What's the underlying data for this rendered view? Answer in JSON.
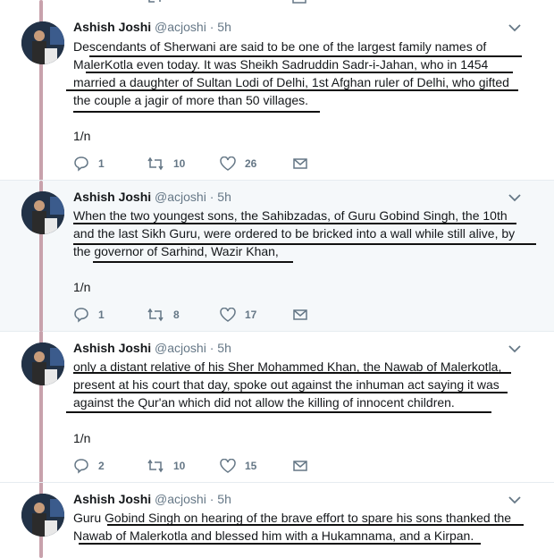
{
  "colors": {
    "thread_line": "#c8a2ac",
    "highlight_bg": "#f5f8fa",
    "meta": "#657786"
  },
  "tweets": [
    {
      "name": "Ashish Joshi",
      "handle": "@acjoshi",
      "dot": "·",
      "time": "5h",
      "lines": [
        "Descendants of Sherwani are said to be one of the largest family names of",
        "MalerKotla even today. It was  Sheikh Sadruddin Sadr-i-Jahan, who in 1454",
        "married a daughter of Sultan Lodi of Delhi, 1st Afghan ruler of Delhi, who gifted",
        "the couple a jagir of more than 50 villages."
      ],
      "count": "1/n",
      "replies": "1",
      "retweets": "10",
      "likes": "26",
      "highlighted": false
    },
    {
      "name": "Ashish Joshi",
      "handle": "@acjoshi",
      "dot": "·",
      "time": "5h",
      "lines": [
        "When the two youngest sons, the Sahibzadas, of Guru Gobind Singh, the 10th",
        "and the last Sikh Guru, were ordered to be bricked into a wall while still alive, by",
        "the governor of Sarhind, Wazir Khan,"
      ],
      "count": "1/n",
      "replies": "1",
      "retweets": "8",
      "likes": "17",
      "highlighted": true
    },
    {
      "name": "Ashish Joshi",
      "handle": "@acjoshi",
      "dot": "·",
      "time": "5h",
      "lines": [
        "only a distant relative of his Sher Mohammed Khan, the Nawab of Malerkotla,",
        "present at his court that day, spoke out against the inhuman act saying it was",
        "against the Qur'an which did not allow the killing of innocent children."
      ],
      "count": "1/n",
      "replies": "2",
      "retweets": "10",
      "likes": "15",
      "highlighted": false
    },
    {
      "name": "Ashish Joshi",
      "handle": "@acjoshi",
      "dot": "·",
      "time": "5h",
      "lines": [
        "Guru Gobind Singh on hearing of the brave effort to spare his sons thanked the",
        "Nawab of Malerkotla and blessed him with a Hukamnama, and a Kirpan."
      ],
      "highlighted": false
    }
  ]
}
